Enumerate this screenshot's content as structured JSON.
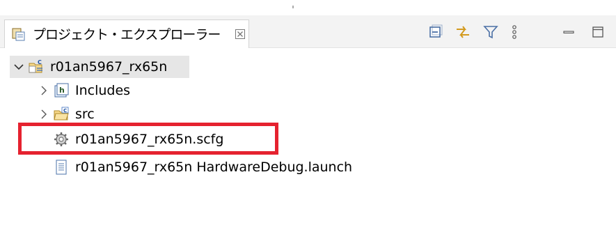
{
  "view": {
    "tab_title": "プロジェクト・エクスプローラー",
    "icons": {
      "view": "project-explorer-icon",
      "close": "close-icon",
      "collapse_all": "collapse-all-icon",
      "link_with_editor": "link-with-editor-icon",
      "filter": "filter-icon",
      "view_menu": "view-menu-icon",
      "minimize": "minimize-icon",
      "maximize": "maximize-icon"
    }
  },
  "tree": {
    "project": {
      "label": "r01an5967_rx65n",
      "expanded": true,
      "selected": true
    },
    "items": [
      {
        "label": "Includes",
        "icon": "includes-folder-icon",
        "expandable": true
      },
      {
        "label": "src",
        "icon": "source-folder-icon",
        "expandable": true
      },
      {
        "label": "r01an5967_rx65n.scfg",
        "icon": "gear-icon",
        "expandable": false,
        "highlighted": true
      },
      {
        "label": "r01an5967_rx65n HardwareDebug.launch",
        "icon": "text-file-icon",
        "expandable": false
      }
    ]
  },
  "colors": {
    "highlight_border": "#e5222f",
    "selection_bg": "#e6e6e6",
    "tab_bar_bg": "#f3f3f3"
  }
}
